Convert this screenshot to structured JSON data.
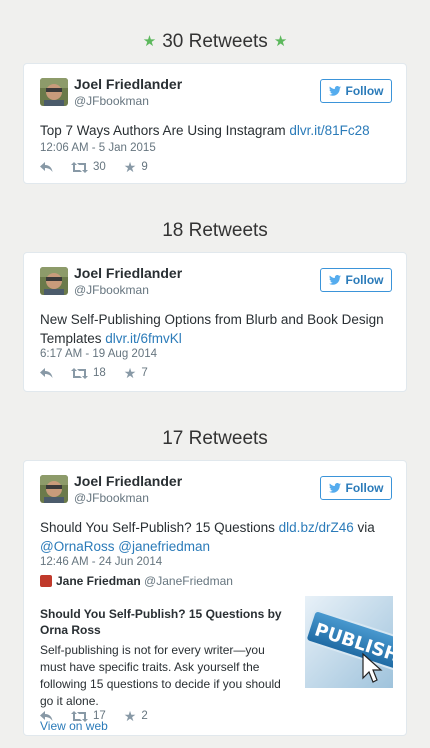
{
  "tweets": [
    {
      "heading": "30 Retweets",
      "author": "Joel Friedlander",
      "handle": "@JFbookman",
      "follow_label": "Follow",
      "text": "Top 7 Ways Authors Are Using Instagram ",
      "link": "dlvr.it/81Fc28",
      "time": "12:06 AM - 5 Jan 2015",
      "retweets": "30",
      "favorites": "9"
    },
    {
      "heading": "18 Retweets",
      "author": "Joel Friedlander",
      "handle": "@JFbookman",
      "follow_label": "Follow",
      "text_line1": "New Self-Publishing Options from Blurb and Book Design",
      "text_line2": "Templates ",
      "link": "dlvr.it/6fmvKl",
      "time": "6:17 AM - 19 Aug 2014",
      "retweets": "18",
      "favorites": "7"
    },
    {
      "heading": "17 Retweets",
      "author": "Joel Friedlander",
      "handle": "@JFbookman",
      "follow_label": "Follow",
      "text": "Should You Self-Publish? 15 Questions ",
      "link": "dld.bz/drZ46",
      "text_via": " via",
      "mention1": "@OrnaRoss",
      "mention2": "@janefriedman",
      "time": "12:46 AM - 24 Jun 2014",
      "quote": {
        "name": "Jane Friedman",
        "handle": "@JaneFriedman",
        "title": "Should You Self-Publish? 15 Questions by Orna Ross",
        "description": "Self-publishing is not for every writer—you must have specific traits. Ask yourself the following 15 questions to decide if you should go it alone.",
        "image_text": "PUBLISH",
        "link": "View on web"
      },
      "retweets": "17",
      "favorites": "2"
    }
  ],
  "colors": {
    "star": "#5cb85c",
    "link": "#2b7bb9",
    "follow_border": "#3b94d9"
  },
  "icons": {
    "heading_star": "star-icon",
    "reply": "reply-icon",
    "retweet": "retweet-icon",
    "favorite": "star-icon",
    "follow": "twitter-bird-icon"
  }
}
